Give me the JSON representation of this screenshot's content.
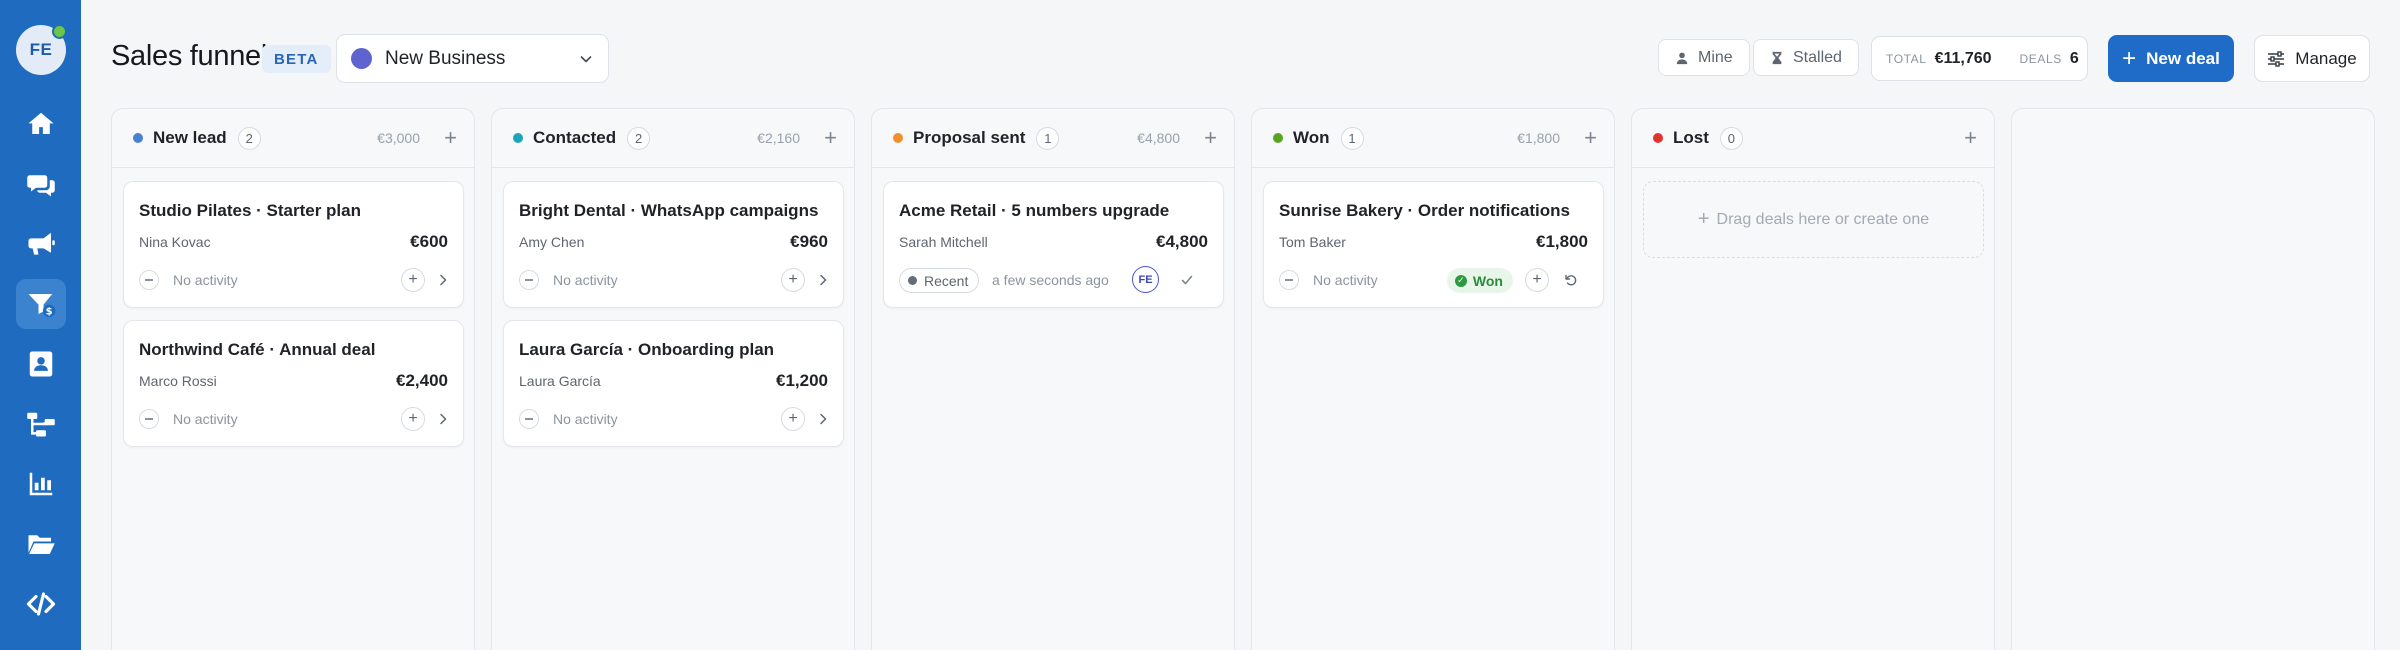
{
  "sidebar": {
    "avatar_initials": "FE",
    "items": [
      {
        "name": "home",
        "icon": "home-icon"
      },
      {
        "name": "conversations",
        "icon": "chat-icon"
      },
      {
        "name": "campaigns",
        "icon": "megaphone-icon"
      },
      {
        "name": "sales-funnel",
        "icon": "funnel-icon",
        "active": true
      },
      {
        "name": "contacts",
        "icon": "contacts-icon"
      },
      {
        "name": "flows",
        "icon": "flow-icon"
      },
      {
        "name": "reports",
        "icon": "chart-icon"
      },
      {
        "name": "files",
        "icon": "folder-icon"
      },
      {
        "name": "developers",
        "icon": "code-icon"
      }
    ]
  },
  "header": {
    "title": "Sales funnel",
    "badge": "BETA",
    "pipeline": {
      "label": "New Business",
      "color": "#5f63cf"
    },
    "filters": {
      "mine": "Mine",
      "stalled": "Stalled"
    },
    "stats": {
      "total_label": "TOTAL",
      "total_value": "€11,760",
      "deals_label": "DEALS",
      "deals_value": "6"
    },
    "new_deal": "New deal",
    "manage": "Manage"
  },
  "columns": [
    {
      "title": "New lead",
      "count": "2",
      "total": "€3,000",
      "color": "#4a7fd4",
      "cards": [
        {
          "title": "Studio Pilates · Starter plan",
          "contact": "Nina Kovac",
          "value": "€600",
          "activity": "No activity"
        },
        {
          "title": "Northwind Café · Annual deal",
          "contact": "Marco Rossi",
          "value": "€2,400",
          "activity": "No activity"
        }
      ]
    },
    {
      "title": "Contacted",
      "count": "2",
      "total": "€2,160",
      "color": "#1aa5b8",
      "cards": [
        {
          "title": "Bright Dental · WhatsApp campaigns",
          "contact": "Amy Chen",
          "value": "€960",
          "activity": "No activity"
        },
        {
          "title": "Laura García · Onboarding plan",
          "contact": "Laura García",
          "value": "€1,200",
          "activity": "No activity"
        }
      ]
    },
    {
      "title": "Proposal sent",
      "count": "1",
      "total": "€4,800",
      "color": "#f0902c",
      "cards": [
        {
          "title": "Acme Retail · 5 numbers upgrade",
          "contact": "Sarah Mitchell",
          "value": "€4,800",
          "recent": "Recent",
          "time": "a few seconds ago",
          "owner": "FE"
        }
      ]
    },
    {
      "title": "Won",
      "count": "1",
      "total": "€1,800",
      "color": "#5aa322",
      "cards": [
        {
          "title": "Sunrise Bakery · Order notifications",
          "contact": "Tom Baker",
          "value": "€1,800",
          "activity": "No activity",
          "status": "Won"
        }
      ]
    },
    {
      "title": "Lost",
      "count": "0",
      "color": "#e0322f",
      "dropzone": "Drag deals here or create one"
    }
  ]
}
